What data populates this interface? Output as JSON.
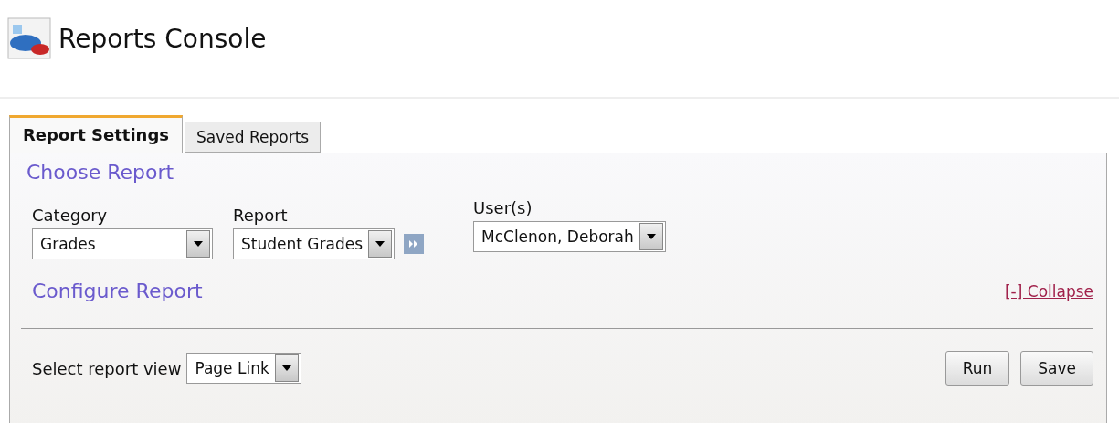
{
  "header": {
    "title": "Reports Console"
  },
  "tabs": [
    {
      "label": "Report Settings",
      "selected": true
    },
    {
      "label": "Saved Reports",
      "selected": false
    }
  ],
  "choose_report": {
    "heading": "Choose Report",
    "fields": [
      {
        "label": "Category",
        "value": "Grades"
      },
      {
        "label": "Report",
        "value": "Student Grades",
        "go_button": true
      },
      {
        "label": "User(s)",
        "value": "McClenon, Deborah"
      }
    ]
  },
  "configure_report": {
    "heading": "Configure Report",
    "collapse_link": "[-] Collapse"
  },
  "report_view": {
    "label": "Select report view",
    "value": "Page Link"
  },
  "buttons": [
    "Run",
    "Save"
  ]
}
